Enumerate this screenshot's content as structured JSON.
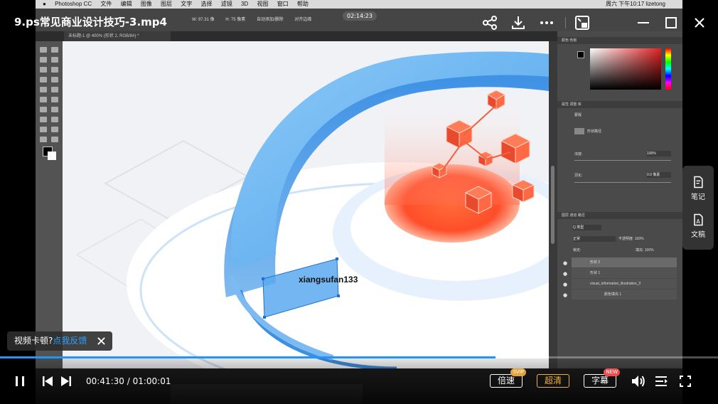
{
  "player": {
    "title": "9.ps常见商业设计技巧-3.mp4",
    "timestamp_pill": "02:14:23",
    "current_time": "00:41:30",
    "time_separator": " / ",
    "duration": "01:00:01",
    "progress_fraction": 0.69,
    "accent_color": "#1e96ff"
  },
  "top_actions": [
    {
      "name": "share-icon"
    },
    {
      "name": "download-icon"
    },
    {
      "name": "more-icon"
    },
    {
      "name": "picture-in-picture-icon"
    },
    {
      "name": "minimize-icon"
    },
    {
      "name": "maximize-icon"
    },
    {
      "name": "close-icon"
    }
  ],
  "side_panel": {
    "notes_label": "笔记",
    "transcript_label": "文稿"
  },
  "feedback": {
    "prompt": "视频卡顿?",
    "link": "点我反馈"
  },
  "controls": {
    "speed_label": "倍速",
    "speed_badge": "SVIP",
    "quality_label": "超清",
    "subtitle_label": "字幕",
    "subtitle_badge": "NEW",
    "quality_color": "#f0b23a"
  },
  "recording": {
    "menubar": [
      "Photoshop CC",
      "文件",
      "编辑",
      "图像",
      "图层",
      "文字",
      "选择",
      "滤镜",
      "3D",
      "视图",
      "窗口",
      "帮助"
    ],
    "menubar_right": "周六 下午10:17  lizetong",
    "options": [
      "W: 97.31 像",
      "H: 75 像素",
      "自动添加/删除",
      "对齐边缘"
    ],
    "doc_tab": "未标题-1 @ 400% (形状 2, RGB/8#) *",
    "watermark": "xiangsufan133",
    "panels": {
      "color_tabs": "颜色    色板",
      "properties_tabs": "属性    调整    库",
      "mask_label": "蒙版",
      "shape_path": "形状路径",
      "density_label": "浓度:",
      "density_value": "100%",
      "feather_label": "羽化:",
      "feather_value": "0.0 像素",
      "layers_tabs": "图层    通道    路径",
      "kind_filter": "Q 类型",
      "blend_mode": "正常",
      "opacity": "不透明度: 100%",
      "lock": "锁定:",
      "fill": "填充: 100%"
    },
    "layers": [
      "形状 2",
      "形状 1",
      "visual_information_illustration_3",
      "颜色填充 1"
    ]
  }
}
